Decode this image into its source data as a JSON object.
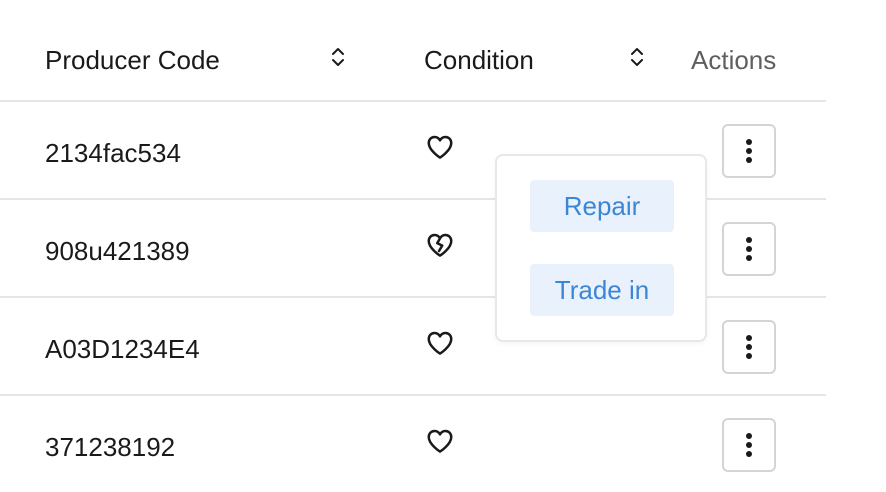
{
  "table": {
    "columns": {
      "producer_code": "Producer Code",
      "condition": "Condition",
      "actions": "Actions"
    },
    "rows": [
      {
        "producer_code": "2134fac534",
        "condition_icon": "heart-icon"
      },
      {
        "producer_code": "908u421389",
        "condition_icon": "broken-heart-icon"
      },
      {
        "producer_code": "A03D1234E4",
        "condition_icon": "heart-icon"
      },
      {
        "producer_code": "371238192",
        "condition_icon": "heart-icon"
      }
    ]
  },
  "actions_menu": {
    "items": [
      "Repair",
      "Trade in"
    ]
  },
  "colors": {
    "menu_item_text": "#3c86d6",
    "menu_item_bg": "#e9f2fc",
    "divider": "#e5e5e5"
  }
}
